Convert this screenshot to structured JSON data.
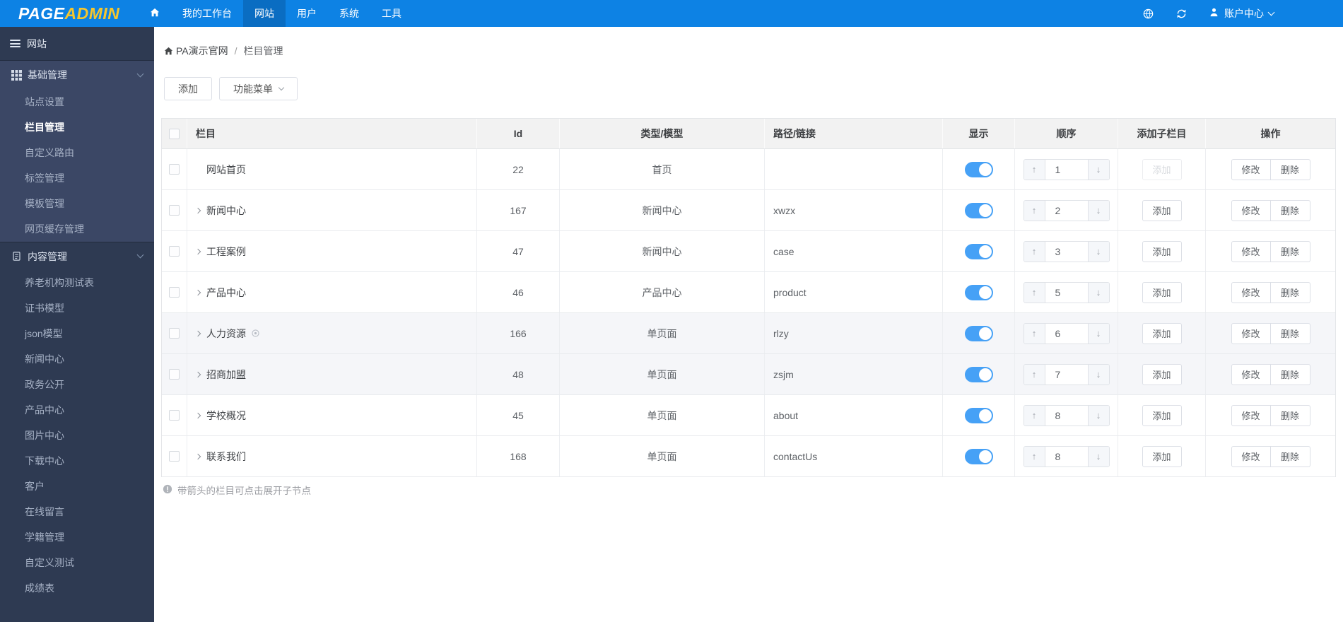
{
  "topbar": {
    "logo_part1": "PAGE",
    "logo_part2": "ADMIN",
    "nav_items": [
      {
        "label": "我的工作台",
        "active": false
      },
      {
        "label": "网站",
        "active": true
      },
      {
        "label": "用户",
        "active": false
      },
      {
        "label": "系统",
        "active": false
      },
      {
        "label": "工具",
        "active": false
      }
    ],
    "account_label": "账户中心"
  },
  "sidebar": {
    "title": "网站",
    "sections": [
      {
        "label": "基础管理",
        "icon": "grid",
        "highlighted": true,
        "items": [
          {
            "label": "站点设置",
            "active": false
          },
          {
            "label": "栏目管理",
            "active": true
          },
          {
            "label": "自定义路由",
            "active": false
          },
          {
            "label": "标签管理",
            "active": false
          },
          {
            "label": "模板管理",
            "active": false
          },
          {
            "label": "网页缓存管理",
            "active": false
          }
        ]
      },
      {
        "label": "内容管理",
        "icon": "document",
        "highlighted": false,
        "items": [
          {
            "label": "养老机构测试表",
            "active": false
          },
          {
            "label": "证书模型",
            "active": false
          },
          {
            "label": "json模型",
            "active": false
          },
          {
            "label": "新闻中心",
            "active": false
          },
          {
            "label": "政务公开",
            "active": false
          },
          {
            "label": "产品中心",
            "active": false
          },
          {
            "label": "图片中心",
            "active": false
          },
          {
            "label": "下载中心",
            "active": false
          },
          {
            "label": "客户",
            "active": false
          },
          {
            "label": "在线留言",
            "active": false
          },
          {
            "label": "学籍管理",
            "active": false
          },
          {
            "label": "自定义测试",
            "active": false
          },
          {
            "label": "成绩表",
            "active": false
          }
        ]
      }
    ]
  },
  "breadcrumb": {
    "site": "PA演示官网",
    "separator": "/",
    "page": "栏目管理"
  },
  "toolbar": {
    "add_label": "添加",
    "menu_label": "功能菜单"
  },
  "table": {
    "headers": {
      "column": "栏目",
      "id": "Id",
      "type": "类型/模型",
      "path": "路径/链接",
      "visible": "显示",
      "order": "顺序",
      "add_child": "添加子栏目",
      "actions": "操作"
    },
    "action_labels": {
      "add": "添加",
      "edit": "修改",
      "delete": "删除"
    },
    "rows": [
      {
        "name": "网站首页",
        "expandable": false,
        "hidden_icon": false,
        "id": "22",
        "type": "首页",
        "path": "",
        "visible": true,
        "order": "1",
        "add_enabled": false,
        "shaded": false
      },
      {
        "name": "新闻中心",
        "expandable": true,
        "hidden_icon": false,
        "id": "167",
        "type": "新闻中心",
        "path": "xwzx",
        "visible": true,
        "order": "2",
        "add_enabled": true,
        "shaded": false
      },
      {
        "name": "工程案例",
        "expandable": true,
        "hidden_icon": false,
        "id": "47",
        "type": "新闻中心",
        "path": "case",
        "visible": true,
        "order": "3",
        "add_enabled": true,
        "shaded": false
      },
      {
        "name": "产品中心",
        "expandable": true,
        "hidden_icon": false,
        "id": "46",
        "type": "产品中心",
        "path": "product",
        "visible": true,
        "order": "5",
        "add_enabled": true,
        "shaded": false
      },
      {
        "name": "人力资源",
        "expandable": true,
        "hidden_icon": true,
        "id": "166",
        "type": "单页面",
        "path": "rlzy",
        "visible": true,
        "order": "6",
        "add_enabled": true,
        "shaded": true
      },
      {
        "name": "招商加盟",
        "expandable": true,
        "hidden_icon": false,
        "id": "48",
        "type": "单页面",
        "path": "zsjm",
        "visible": true,
        "order": "7",
        "add_enabled": true,
        "shaded": true
      },
      {
        "name": "学校概况",
        "expandable": true,
        "hidden_icon": false,
        "id": "45",
        "type": "单页面",
        "path": "about",
        "visible": true,
        "order": "8",
        "add_enabled": true,
        "shaded": false
      },
      {
        "name": "联系我们",
        "expandable": true,
        "hidden_icon": false,
        "id": "168",
        "type": "单页面",
        "path": "contactUs",
        "visible": true,
        "order": "8",
        "add_enabled": true,
        "shaded": false
      }
    ]
  },
  "footer_note": "带箭头的栏目可点击展开子节点",
  "colors": {
    "topbar": "#0d82e4",
    "topbar_active": "#0a6dc2",
    "logo_accent": "#f6c62d",
    "sidebar": "#2e3a52",
    "sidebar_highlight": "#3b4765",
    "toggle_on": "#46a1f6",
    "table_header_bg": "#f2f2f2",
    "shaded_row_bg": "#f5f6f9"
  }
}
